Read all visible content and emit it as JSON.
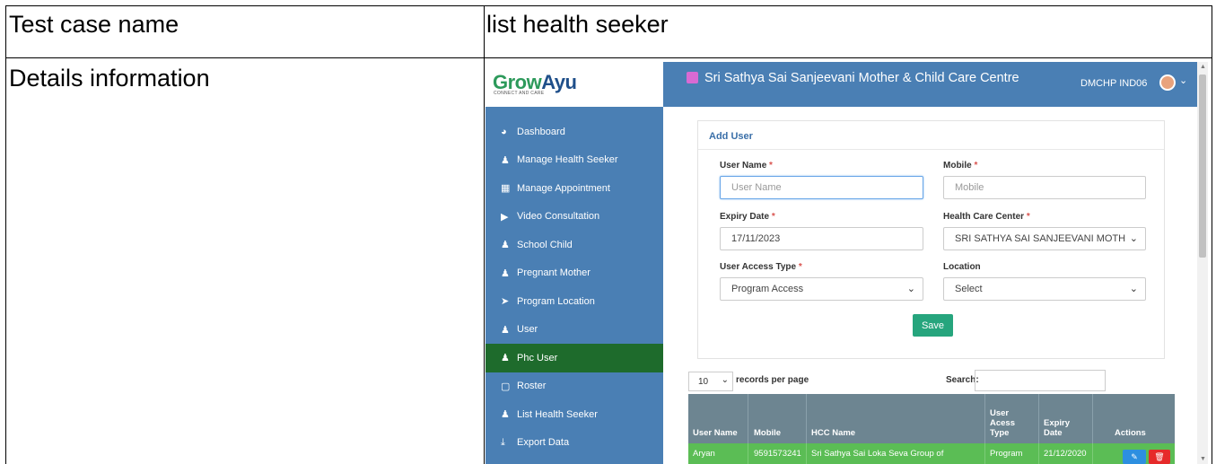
{
  "doc": {
    "row1_label": "Test case name",
    "row1_value": "list health seeker",
    "row2_label": "Details information"
  },
  "app": {
    "logo_grow": "Grow",
    "logo_ayu": "Ayu",
    "logo_tagline": "CONNECT AND CARE",
    "title": "Sri Sathya Sai Sanjeevani Mother & Child Care Centre",
    "user": "DMCHP IND06",
    "sidebar": {
      "items": [
        {
          "label": "Dashboard",
          "icon": "dashboard-icon"
        },
        {
          "label": "Manage Health Seeker",
          "icon": "user-icon"
        },
        {
          "label": "Manage Appointment",
          "icon": "calendar-icon"
        },
        {
          "label": "Video Consultation",
          "icon": "play-circle-icon"
        },
        {
          "label": "School Child",
          "icon": "user-icon"
        },
        {
          "label": "Pregnant Mother",
          "icon": "user-icon"
        },
        {
          "label": "Program Location",
          "icon": "location-arrow-icon"
        },
        {
          "label": "User",
          "icon": "user-icon"
        },
        {
          "label": "Phc User",
          "icon": "user-icon",
          "active": true
        },
        {
          "label": "Roster",
          "icon": "calendar-outline-icon"
        },
        {
          "label": "List Health Seeker",
          "icon": "user-icon"
        },
        {
          "label": "Export Data",
          "icon": "download-icon"
        }
      ]
    },
    "form": {
      "title": "Add User",
      "username_label": "User Name",
      "username_placeholder": "User Name",
      "mobile_label": "Mobile",
      "mobile_placeholder": "Mobile",
      "expiry_label": "Expiry Date",
      "expiry_value": "17/11/2023",
      "hcc_label": "Health Care Center",
      "hcc_value": "SRI SATHYA SAI SANJEEVANI MOTH",
      "access_label": "User Access Type",
      "access_value": "Program Access",
      "location_label": "Location",
      "location_value": "Select",
      "required_mark": "*",
      "save_label": "Save"
    },
    "table": {
      "page_size": "10",
      "records_label": "records per page",
      "search_label": "Search:",
      "headers": [
        "User Name",
        "Mobile",
        "HCC Name",
        "User\nAcess\nType",
        "Expiry\nDate",
        "Actions"
      ],
      "rows": [
        [
          "Aryan",
          "9591573241",
          "Sri Sathya Sai Loka Seva Group of",
          "Program",
          "21/12/2020"
        ]
      ]
    },
    "colors": {
      "sidebar": "#4a7fb4",
      "active_item": "#1e6b2c",
      "save_button": "#26a57d",
      "table_header": "#6d8591",
      "table_row": "#5bbd55",
      "edit_button": "#2d8fe0",
      "delete_button": "#e62a2a"
    }
  }
}
